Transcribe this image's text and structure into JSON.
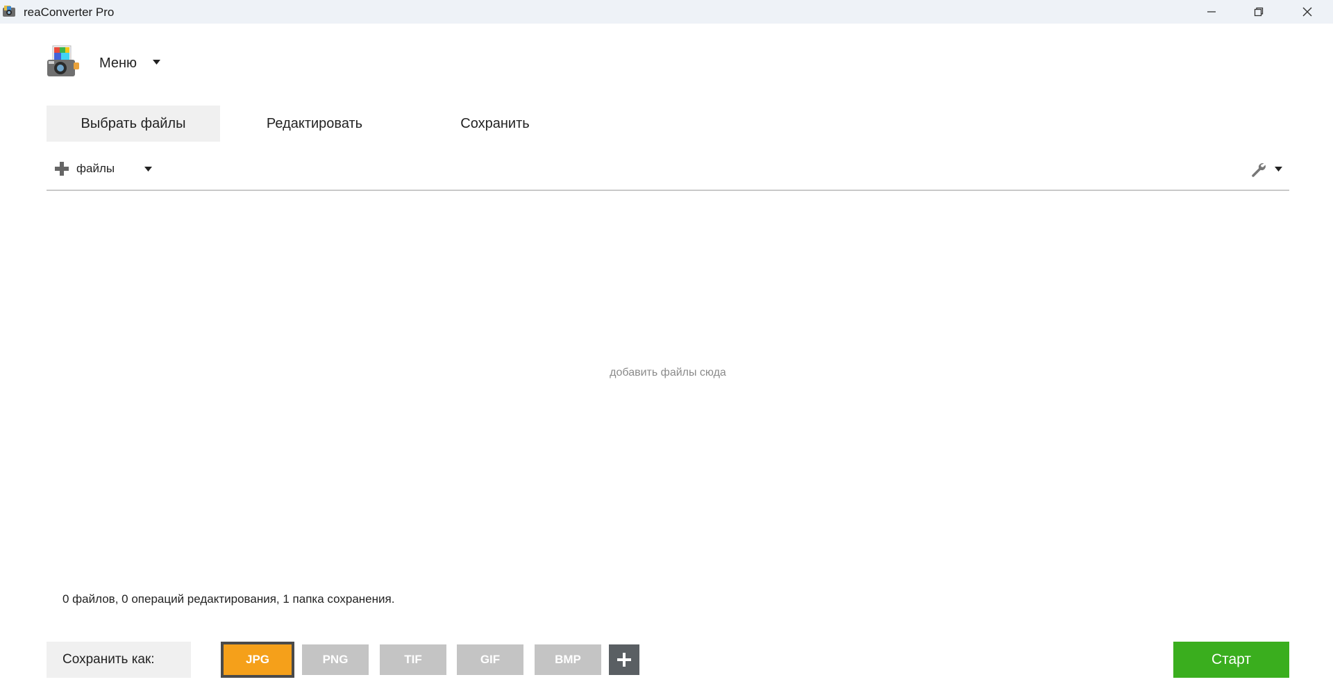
{
  "window": {
    "title": "reaConverter Pro"
  },
  "menu": {
    "label": "Меню"
  },
  "tabs": [
    {
      "label": "Выбрать файлы",
      "active": true
    },
    {
      "label": "Редактировать",
      "active": false
    },
    {
      "label": "Сохранить",
      "active": false
    }
  ],
  "toolbar": {
    "add_files_label": "файлы",
    "add_icon": "plus-icon",
    "settings_icon": "wrench-icon"
  },
  "drop_area": {
    "hint": "добавить файлы сюда"
  },
  "status": {
    "text": "0 файлов, 0 операций редактирования, 1 папка сохранения."
  },
  "save_as": {
    "label": "Сохранить как:",
    "formats": [
      {
        "label": "JPG",
        "selected": true
      },
      {
        "label": "PNG",
        "selected": false
      },
      {
        "label": "TIF",
        "selected": false
      },
      {
        "label": "GIF",
        "selected": false
      },
      {
        "label": "BMP",
        "selected": false
      }
    ],
    "selected_color": "#f5a01a",
    "inactive_color": "#c4c4c4"
  },
  "start": {
    "label": "Старт",
    "color": "#3aae1e"
  }
}
